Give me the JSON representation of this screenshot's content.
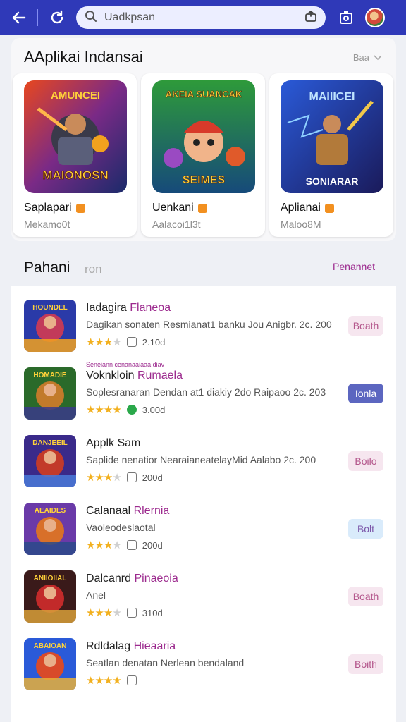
{
  "topbar": {
    "search_value": "Uadkpsan",
    "colors": {
      "bar": "#2f39b8",
      "search_bg": "#eceeff"
    },
    "icons": [
      "back-arrow-icon",
      "refresh-icon",
      "search-icon",
      "share-icon",
      "screenshot-icon",
      "avatar"
    ]
  },
  "featured": {
    "title": "AAplikai Indansai",
    "more_label": "Baa",
    "cards": [
      {
        "art_text_top": "AMUNCEI",
        "art_text_bottom": "MAIONOSN",
        "name": "Saplapari",
        "sub": "Mekamo0t"
      },
      {
        "art_text_top": "AKEIA SUANCAK",
        "art_text_bottom": "SEIMES",
        "name": "Uenkani",
        "sub": "Aalacoi1l3t"
      },
      {
        "art_text_top": "MAIIICEI",
        "art_text_bottom": "SONIARAR",
        "name": "Aplianai",
        "sub": "Maloo8M"
      }
    ]
  },
  "section": {
    "title": "Pahani",
    "subtitle": "ron",
    "action": "Penannet"
  },
  "apps": [
    {
      "title": "Iadagira",
      "accent": "Flaneoa",
      "desc": "Dagikan sonaten Resmianat1 banku Jou Anigbr. 2c. 200",
      "stars": 3,
      "icon": "square",
      "count": "2.10d",
      "button": "Boath",
      "btn_style": "pink",
      "art_text": "HOUNDEL"
    },
    {
      "title": "Voknkloin",
      "accent": "Rumaela",
      "tiny": "Seneiann cenanaaiaaa diav",
      "desc": "Soplesranaran Dendan at1 diakiy 2do Raipaoo 2c. 203",
      "stars": 4,
      "icon": "green",
      "count": "3.00d",
      "button": "Ionla",
      "btn_style": "purple",
      "art_text": "HOMADIE"
    },
    {
      "title": "Applk Sam",
      "accent": "",
      "desc": "Saplide nenatior NearaianeatelayMid Aalabo 2c. 200",
      "stars": 3,
      "icon": "square",
      "count": "200d",
      "button": "Boilo",
      "btn_style": "pink",
      "art_text": "DANJEEIL"
    },
    {
      "title": "Calanaal",
      "accent": "Rlernia",
      "desc": "Vaoleodeslaotal",
      "stars": 3,
      "icon": "square",
      "count": "200d",
      "button": "Bolt",
      "btn_style": "blue",
      "art_text": "AEAIDES"
    },
    {
      "title": "Dalcanrd",
      "accent": "Pinaeoia",
      "desc": "Anel",
      "stars": 3,
      "icon": "square",
      "count": "310d",
      "button": "Boath",
      "btn_style": "pink",
      "art_text": "ANIIOIIAL"
    },
    {
      "title": "Rdldalag",
      "accent": "Hieaaria",
      "desc": "Seatlan denatan Nerlean bendaland",
      "stars": 4,
      "icon": "square",
      "count": "",
      "button": "Boith",
      "btn_style": "pink",
      "art_text": "ABAIOAN"
    }
  ]
}
